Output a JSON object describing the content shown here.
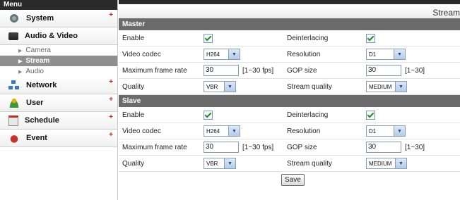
{
  "menu": {
    "title": "Menu",
    "items": [
      {
        "label": "System",
        "icon": "gear-icon",
        "plus": "+"
      },
      {
        "label": "Audio & Video",
        "icon": "camera-icon",
        "plus": ""
      },
      {
        "label": "Network",
        "icon": "network-icon",
        "plus": "+"
      },
      {
        "label": "User",
        "icon": "user-icon",
        "plus": "+"
      },
      {
        "label": "Schedule",
        "icon": "calendar-icon",
        "plus": "+"
      },
      {
        "label": "Event",
        "icon": "alarm-icon",
        "plus": "+"
      }
    ],
    "subitems": [
      {
        "label": "Camera",
        "active": false
      },
      {
        "label": "Stream",
        "active": true
      },
      {
        "label": "Audio",
        "active": false
      }
    ]
  },
  "page": {
    "title": "Stream"
  },
  "master": {
    "title": "Master",
    "enable_label": "Enable",
    "enable_checked": true,
    "deinterlacing_label": "Deinterlacing",
    "deinterlacing_checked": true,
    "codec_label": "Video codec",
    "codec_value": "H264",
    "resolution_label": "Resolution",
    "resolution_value": "D1",
    "fps_label": "Maximum frame rate",
    "fps_value": "30",
    "fps_hint": "[1~30 fps]",
    "gop_label": "GOP size",
    "gop_value": "30",
    "gop_hint": "[1~30]",
    "quality_label": "Quality",
    "quality_value": "VBR",
    "stream_quality_label": "Stream quality",
    "stream_quality_value": "MEDIUM"
  },
  "slave": {
    "title": "Slave",
    "enable_label": "Enable",
    "enable_checked": true,
    "deinterlacing_label": "Deinterlacing",
    "deinterlacing_checked": true,
    "codec_label": "Video codec",
    "codec_value": "H264",
    "resolution_label": "Resolution",
    "resolution_value": "D1",
    "fps_label": "Maximum frame rate",
    "fps_value": "30",
    "fps_hint": "[1~30 fps]",
    "gop_label": "GOP size",
    "gop_value": "30",
    "gop_hint": "[1~30]",
    "quality_label": "Quality",
    "quality_value": "VBR",
    "stream_quality_label": "Stream quality",
    "stream_quality_value": "MEDIUM"
  },
  "actions": {
    "save_label": "Save"
  },
  "colors": {
    "section_header": "#6b6b6b",
    "active_subitem": "#8f8f8f",
    "plus": "#cc2222"
  }
}
